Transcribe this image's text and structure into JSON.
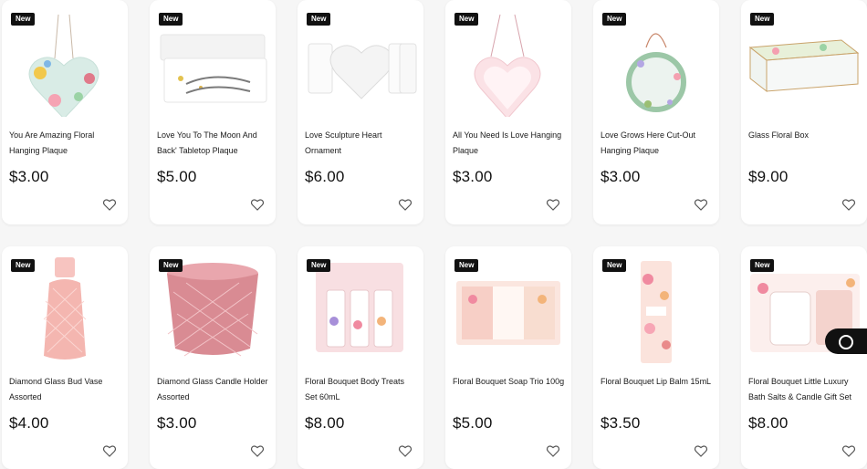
{
  "badge_label": "New",
  "products": [
    {
      "name": "You Are Amazing Floral Hanging Plaque",
      "price": "$3.00",
      "image": "heart-plaque-floral"
    },
    {
      "name": "Love You To The Moon And Back' Tabletop Plaque",
      "price": "$5.00",
      "image": "love-tabletop-plaque"
    },
    {
      "name": "Love Sculpture Heart Ornament",
      "price": "$6.00",
      "image": "love-sculpture"
    },
    {
      "name": "All You Need Is Love Hanging Plaque",
      "price": "$3.00",
      "image": "pink-heart-plaque"
    },
    {
      "name": "Love Grows Here Cut-Out Hanging Plaque",
      "price": "$3.00",
      "image": "wreath-plaque"
    },
    {
      "name": "Glass Floral Box",
      "price": "$9.00",
      "image": "glass-box"
    },
    {
      "name": "Diamond Glass Bud Vase Assorted",
      "price": "$4.00",
      "image": "bud-vase"
    },
    {
      "name": "Diamond Glass Candle Holder Assorted",
      "price": "$3.00",
      "image": "candle-holder"
    },
    {
      "name": "Floral Bouquet Body Treats Set 60mL",
      "price": "$8.00",
      "image": "body-treats-set"
    },
    {
      "name": "Floral Bouquet Soap Trio 100g",
      "price": "$5.00",
      "image": "soap-trio"
    },
    {
      "name": "Floral Bouquet Lip Balm 15mL",
      "price": "$3.50",
      "image": "lip-balm"
    },
    {
      "name": "Floral Bouquet Little Luxury Bath Salts & Candle Gift Set",
      "price": "$8.00",
      "image": "bath-salts-set"
    }
  ]
}
